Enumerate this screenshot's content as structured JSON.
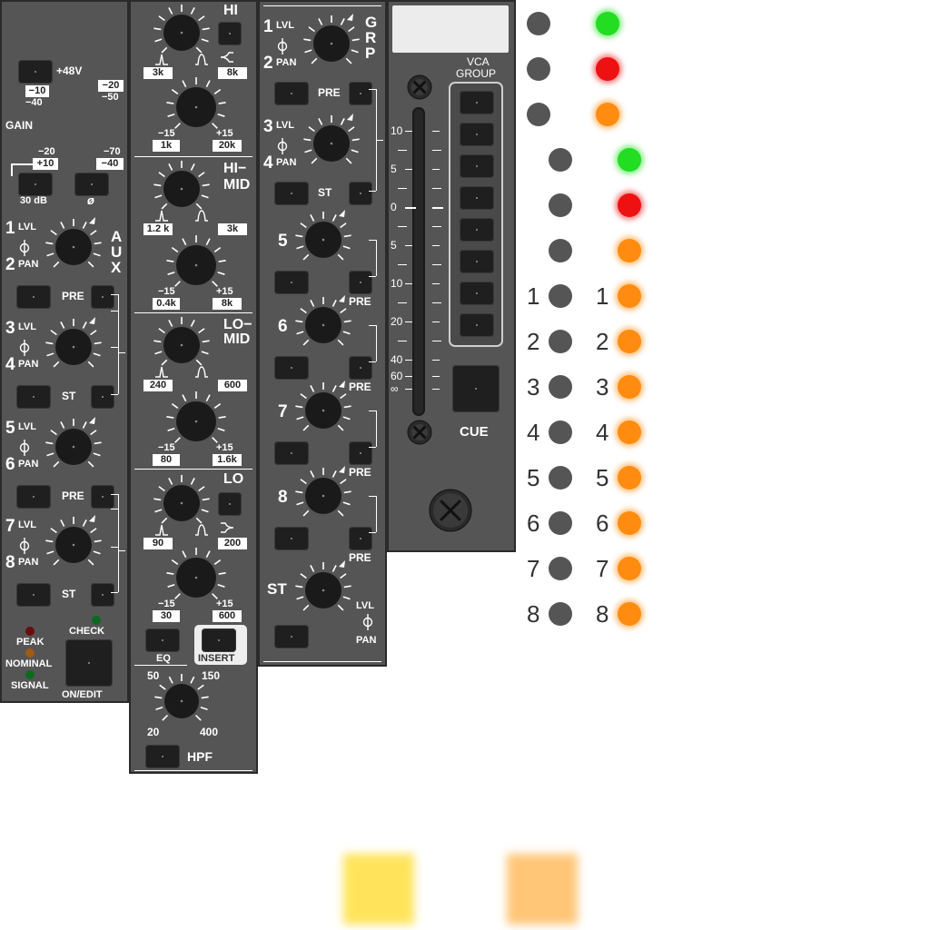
{
  "input_strip": {
    "phantom_label": "+48V",
    "gain_label": "GAIN",
    "gain_scale": {
      "tl_top": "−10",
      "tl_bot": "−40",
      "tr_top": "−20",
      "tr_bot": "−50",
      "bl_top": "−20",
      "bl_bot": "+10",
      "br_top": "−70",
      "br_bot": "−40"
    },
    "pad_label": "30 dB",
    "phase_label": "ø",
    "aux_title": "AUX",
    "aux_sends": [
      {
        "num_top": "1",
        "num_bot": "2",
        "lvl": "LVL",
        "pan": "PAN",
        "btn": "PRE"
      },
      {
        "num_top": "3",
        "num_bot": "4",
        "lvl": "LVL",
        "pan": "PAN",
        "btn": "ST"
      },
      {
        "num_top": "5",
        "num_bot": "6",
        "lvl": "LVL",
        "pan": "PAN",
        "btn": "PRE"
      },
      {
        "num_top": "7",
        "num_bot": "8",
        "lvl": "LVL",
        "pan": "PAN",
        "btn": "ST"
      }
    ],
    "meter_labels": {
      "peak": "PEAK",
      "nominal": "NOMINAL",
      "signal": "SIGNAL"
    },
    "check_label": "CHECK",
    "on_edit_label": "ON/EDIT"
  },
  "eq_strip": {
    "hi": {
      "title": "HI",
      "q_lo": "3k",
      "q_hi": "8k",
      "g_min": "−15",
      "g_max": "+15",
      "f_lo": "1k",
      "f_hi": "20k"
    },
    "himid": {
      "title_1": "HI−",
      "title_2": "MID",
      "q_lo": "1.2 k",
      "q_hi": "3k",
      "g_min": "−15",
      "g_max": "+15",
      "f_lo": "0.4k",
      "f_hi": "8k"
    },
    "lomid": {
      "title_1": "LO−",
      "title_2": "MID",
      "q_lo": "240",
      "q_hi": "600",
      "g_min": "−15",
      "g_max": "+15",
      "f_lo": "80",
      "f_hi": "1.6k"
    },
    "lo": {
      "title": "LO",
      "q_lo": "90",
      "q_hi": "200",
      "g_min": "−15",
      "g_max": "+15",
      "f_lo": "30",
      "f_hi": "600"
    },
    "eq_label": "EQ",
    "insert_label": "INSERT",
    "hpf": {
      "tl": "50",
      "tr": "150",
      "bl": "20",
      "br": "400",
      "label": "HPF"
    }
  },
  "group_strip": {
    "title": "GRP",
    "sends": [
      {
        "num_top": "1",
        "num_bot": "2",
        "lvl": "LVL",
        "pan": "PAN",
        "btn": "PRE"
      },
      {
        "num_top": "3",
        "num_bot": "4",
        "lvl": "LVL",
        "pan": "PAN",
        "btn": "ST"
      },
      {
        "num": "5",
        "btn": "PRE"
      },
      {
        "num": "6",
        "btn": "PRE"
      },
      {
        "num": "7",
        "btn": "PRE"
      },
      {
        "num": "8",
        "btn": "PRE"
      }
    ],
    "st": {
      "label": "ST",
      "lvl": "LVL",
      "pan": "PAN"
    }
  },
  "fader_strip": {
    "scale": [
      "10",
      "5",
      "0",
      "5",
      "10",
      "20",
      "40",
      "60",
      "∞"
    ],
    "vca_title_1": "VCA",
    "vca_title_2": "GROUP",
    "vca_count": 8,
    "cue_label": "CUE"
  },
  "indicator_rows": [
    {
      "left": "",
      "right": "",
      "color": "#22dd22"
    },
    {
      "left": "",
      "right": "",
      "color": "#ee1111"
    },
    {
      "left": "",
      "right": "",
      "color": "#ff8c10"
    },
    {
      "left": "",
      "right": "",
      "color": "#22dd22"
    },
    {
      "left": "",
      "right": "",
      "color": "#ee1111"
    },
    {
      "left": "",
      "right": "",
      "color": "#ff8c10"
    },
    {
      "left": "1",
      "right": "1",
      "color": "#ff8c10"
    },
    {
      "left": "2",
      "right": "2",
      "color": "#ff8c10"
    },
    {
      "left": "3",
      "right": "3",
      "color": "#ff8c10"
    },
    {
      "left": "4",
      "right": "4",
      "color": "#ff8c10"
    },
    {
      "left": "5",
      "right": "5",
      "color": "#ff8c10"
    },
    {
      "left": "6",
      "right": "6",
      "color": "#ff8c10"
    },
    {
      "left": "7",
      "right": "7",
      "color": "#ff8c10"
    },
    {
      "left": "8",
      "right": "8",
      "color": "#ff8c10"
    }
  ],
  "colors": {
    "panel": "#555555",
    "knob": "#1a1a1a",
    "led_green": "#22dd22",
    "led_red": "#ee1111",
    "led_orange": "#ff8c10",
    "swatch_yellow": "#ffe14a",
    "swatch_orange": "#ffc06a"
  },
  "icons": {
    "screw": "screw-icon",
    "knob": "rotary-knob-icon",
    "peak_shape": "peak-filter-icon",
    "shelf_shape": "shelf-filter-icon"
  }
}
